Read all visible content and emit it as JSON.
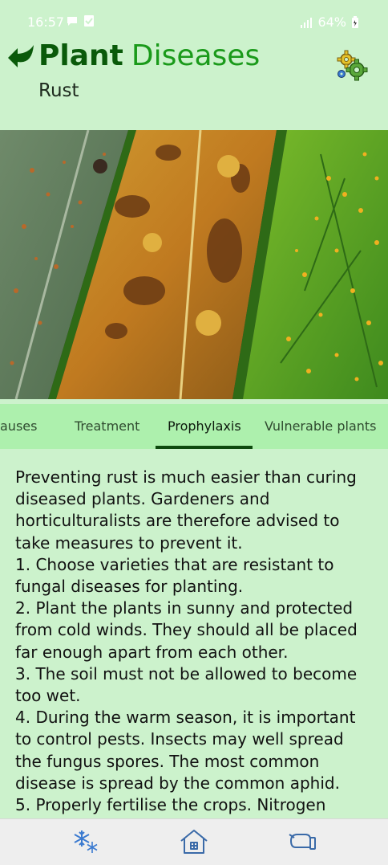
{
  "status_bar": {
    "time": "16:57",
    "battery": "64%",
    "icons": [
      "chat-bubble-icon",
      "check-clipboard-icon",
      "signal-icon",
      "battery-icon"
    ]
  },
  "header": {
    "title_word1": "Plant",
    "title_word2": "Diseases",
    "subtitle": "Rust",
    "colors": {
      "title_dark": "#0a5a0a",
      "title_light": "#1a9a1a",
      "background": "#ccf2cc"
    }
  },
  "tabs": {
    "items": [
      "auses",
      "Treatment",
      "Prophylaxis",
      "Vulnerable plants"
    ],
    "active": "Prophylaxis"
  },
  "content": {
    "text": "Preventing rust is much easier than curing diseased plants. Gardeners and horticulturalists are therefore advised to take measures to prevent it.\n1.  Choose varieties that are resistant to fungal diseases for planting.\n2.  Plant the plants in sunny and protected from cold winds. They should all be placed far enough apart from each other.\n3.  The soil must not be allowed to become too wet.\n4.  During the warm season, it is important to control pests. Insects may well spread the fungus spores. The most common disease is spread by the common aphid.\n5.  Properly fertilise the crops. Nitrogen"
  },
  "bottom_nav": {
    "items": [
      "snowflake-icon",
      "home-icon",
      "glove-icon"
    ]
  }
}
